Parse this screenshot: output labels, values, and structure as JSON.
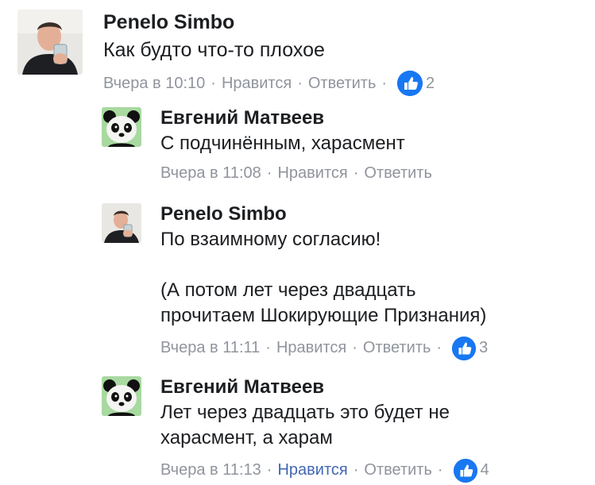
{
  "comments": [
    {
      "author": "Penelo Simbo",
      "avatar": "man-photo-avatar",
      "text": "Как будто что-то плохое",
      "time": "Вчера в 10:10",
      "like_label": "Нравится",
      "reply_label": "Ответить",
      "reaction_icon": "thumbs-up-icon",
      "reaction_count": "2",
      "liked": false
    }
  ],
  "replies": [
    {
      "author": "Евгений Матвеев",
      "avatar": "panda-avatar",
      "text": "С подчинённым, харасмент",
      "time": "Вчера в 11:08",
      "like_label": "Нравится",
      "reply_label": "Ответить",
      "liked": false
    },
    {
      "author": "Penelo Simbo",
      "avatar": "man-photo-avatar",
      "text": "По взаимному согласию!\n\n(А потом лет через двадцать\nпрочитаем Шокирующие Признания)",
      "time": "Вчера в 11:11",
      "like_label": "Нравится",
      "reply_label": "Ответить",
      "reaction_icon": "thumbs-up-icon",
      "reaction_count": "3",
      "liked": false
    },
    {
      "author": "Евгений Матвеев",
      "avatar": "panda-avatar",
      "text": "Лет через двадцать это будет не\nхарасмент, а харам",
      "time": "Вчера в 11:13",
      "like_label": "Нравится",
      "reply_label": "Ответить",
      "reaction_icon": "thumbs-up-icon",
      "reaction_count": "4",
      "liked": true
    }
  ],
  "separator": "·",
  "colors": {
    "text": "#1c1e21",
    "meta": "#90949c",
    "liked_link": "#4267b2",
    "reaction_badge": "#1877f2"
  }
}
